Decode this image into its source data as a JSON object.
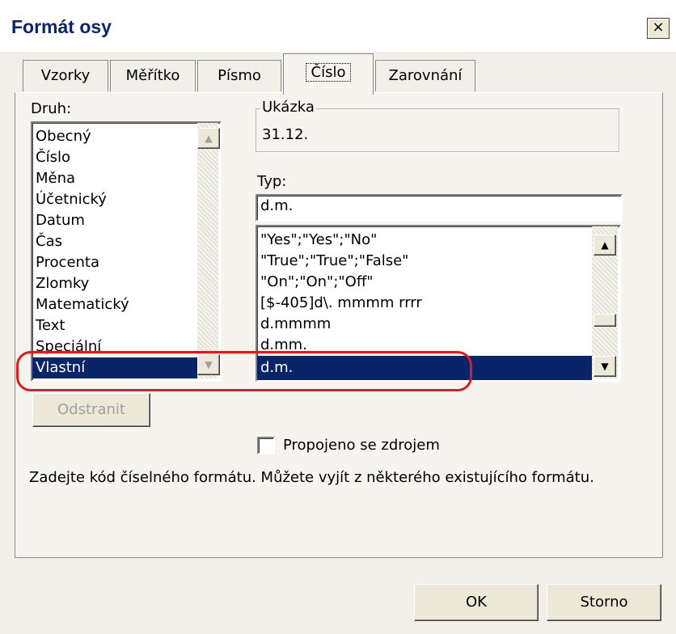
{
  "window": {
    "title": "Formát osy",
    "close_glyph": "×"
  },
  "tabs": [
    {
      "label": "Vzorky",
      "active": false
    },
    {
      "label": "Měřítko",
      "active": false
    },
    {
      "label": "Písmo",
      "active": false
    },
    {
      "label": "Číslo",
      "active": true
    },
    {
      "label": "Zarovnání",
      "active": false
    }
  ],
  "druh": {
    "label": "Druh:",
    "items": [
      "Obecný",
      "Číslo",
      "Měna",
      "Účetnický",
      "Datum",
      "Čas",
      "Procenta",
      "Zlomky",
      "Matematický",
      "Text",
      "Speciální",
      "Vlastní"
    ],
    "selected": "Vlastní"
  },
  "ukazka": {
    "label": "Ukázka",
    "value": "31.12."
  },
  "typ": {
    "label": "Typ:",
    "input_value": "d.m.",
    "items": [
      "\"Yes\";\"Yes\";\"No\"",
      "\"True\";\"True\";\"False\"",
      "\"On\";\"On\";\"Off\"",
      "[$-405]d\\. mmmm rrrr",
      "d.mmmm",
      "d.mm.",
      "d.m."
    ],
    "selected": "d.m."
  },
  "buttons": {
    "delete": "Odstranit",
    "ok": "OK",
    "cancel": "Storno"
  },
  "linked_checkbox": {
    "label": "Propojeno se zdrojem",
    "checked": false
  },
  "hint": "Zadejte kód číselného formátu. Můžete vyjít z některého existujícího formátu.",
  "icons": {
    "scroll_up": "up-arrow-icon",
    "scroll_down": "down-arrow-icon",
    "close": "close-icon"
  },
  "colors": {
    "selection": "#0a246a",
    "annotation": "#e01b1b"
  }
}
